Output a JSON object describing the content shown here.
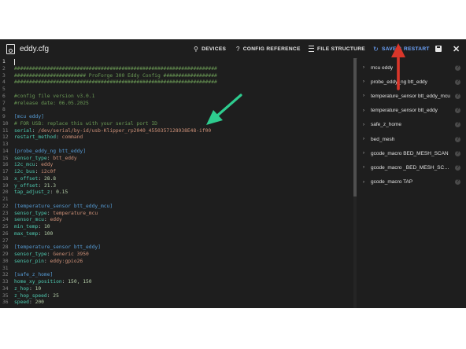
{
  "header": {
    "title": "eddy.cfg",
    "devices_label": "DEVICES",
    "config_reference_label": "CONFIG REFERENCE",
    "file_structure_label": "FILE STRUCTURE",
    "save_restart_label": "SAVE & RESTART",
    "help_glyph": "?",
    "save_restart_glyph": "↻",
    "close_glyph": "✕",
    "devices_glyph": "⚲"
  },
  "colors": {
    "accent": "#6fa6ff",
    "background": "#1e1e1e",
    "comment": "#6a9955",
    "section": "#569cd6",
    "key": "#4ec9b0",
    "string_value": "#ce9178",
    "number_value": "#b5cea8",
    "annotation_green": "#2ecc8f",
    "annotation_red": "#d9362a"
  },
  "editor": {
    "lines": [
      {
        "n": "1",
        "parts": []
      },
      {
        "n": "2",
        "parts": [
          {
            "t": "comment",
            "v": "####################################################################"
          }
        ]
      },
      {
        "n": "3",
        "parts": [
          {
            "t": "comment",
            "v": "######################## ProForge 300 Eddy Config ##################"
          }
        ]
      },
      {
        "n": "4",
        "parts": [
          {
            "t": "comment",
            "v": "####################################################################"
          }
        ]
      },
      {
        "n": "5",
        "parts": []
      },
      {
        "n": "6",
        "parts": [
          {
            "t": "comment",
            "v": "#config file version v3.0.1"
          }
        ]
      },
      {
        "n": "7",
        "parts": [
          {
            "t": "comment",
            "v": "#release date: 06.05.2025"
          }
        ]
      },
      {
        "n": "8",
        "parts": []
      },
      {
        "n": "9",
        "parts": [
          {
            "t": "section",
            "v": "[mcu eddy]"
          }
        ]
      },
      {
        "n": "10",
        "parts": [
          {
            "t": "comment",
            "v": "# FOR USB: replace this with your serial port ID"
          }
        ]
      },
      {
        "n": "11",
        "parts": [
          {
            "t": "key",
            "v": "serial"
          },
          {
            "t": "plain",
            "v": ": "
          },
          {
            "t": "val",
            "v": "/dev/serial/by-id/usb-Klipper_rp2040_4550357128938E48-if00"
          }
        ]
      },
      {
        "n": "12",
        "parts": [
          {
            "t": "key",
            "v": "restart_method"
          },
          {
            "t": "plain",
            "v": ": "
          },
          {
            "t": "val",
            "v": "command"
          }
        ]
      },
      {
        "n": "13",
        "parts": []
      },
      {
        "n": "14",
        "parts": [
          {
            "t": "section",
            "v": "[probe_eddy_ng btt_eddy]"
          }
        ]
      },
      {
        "n": "15",
        "parts": [
          {
            "t": "key",
            "v": "sensor_type"
          },
          {
            "t": "plain",
            "v": ": "
          },
          {
            "t": "val",
            "v": "btt_eddy"
          }
        ]
      },
      {
        "n": "16",
        "parts": [
          {
            "t": "key",
            "v": "i2c_mcu"
          },
          {
            "t": "plain",
            "v": ": "
          },
          {
            "t": "val",
            "v": "eddy"
          }
        ]
      },
      {
        "n": "17",
        "parts": [
          {
            "t": "key",
            "v": "i2c_bus"
          },
          {
            "t": "plain",
            "v": ": "
          },
          {
            "t": "val",
            "v": "i2c0f"
          }
        ]
      },
      {
        "n": "18",
        "parts": [
          {
            "t": "key",
            "v": "x_offset"
          },
          {
            "t": "plain",
            "v": ": "
          },
          {
            "t": "num",
            "v": "28.8"
          }
        ]
      },
      {
        "n": "19",
        "parts": [
          {
            "t": "key",
            "v": "y_offset"
          },
          {
            "t": "plain",
            "v": ": "
          },
          {
            "t": "num",
            "v": "21.3"
          }
        ]
      },
      {
        "n": "20",
        "parts": [
          {
            "t": "key",
            "v": "tap_adjust_z"
          },
          {
            "t": "plain",
            "v": ": "
          },
          {
            "t": "num",
            "v": "0.15"
          }
        ]
      },
      {
        "n": "21",
        "parts": []
      },
      {
        "n": "22",
        "parts": [
          {
            "t": "section",
            "v": "[temperature_sensor btt_eddy_mcu]"
          }
        ]
      },
      {
        "n": "23",
        "parts": [
          {
            "t": "key",
            "v": "sensor_type"
          },
          {
            "t": "plain",
            "v": ": "
          },
          {
            "t": "val",
            "v": "temperature_mcu"
          }
        ]
      },
      {
        "n": "24",
        "parts": [
          {
            "t": "key",
            "v": "sensor_mcu"
          },
          {
            "t": "plain",
            "v": ": "
          },
          {
            "t": "val",
            "v": "eddy"
          }
        ]
      },
      {
        "n": "25",
        "parts": [
          {
            "t": "key",
            "v": "min_temp"
          },
          {
            "t": "plain",
            "v": ": "
          },
          {
            "t": "num",
            "v": "10"
          }
        ]
      },
      {
        "n": "26",
        "parts": [
          {
            "t": "key",
            "v": "max_temp"
          },
          {
            "t": "plain",
            "v": ": "
          },
          {
            "t": "num",
            "v": "100"
          }
        ]
      },
      {
        "n": "27",
        "parts": []
      },
      {
        "n": "28",
        "parts": [
          {
            "t": "section",
            "v": "[temperature_sensor btt_eddy]"
          }
        ]
      },
      {
        "n": "29",
        "parts": [
          {
            "t": "key",
            "v": "sensor_type"
          },
          {
            "t": "plain",
            "v": ": "
          },
          {
            "t": "val",
            "v": "Generic 3950"
          }
        ]
      },
      {
        "n": "30",
        "parts": [
          {
            "t": "key",
            "v": "sensor_pin"
          },
          {
            "t": "plain",
            "v": ": "
          },
          {
            "t": "val",
            "v": "eddy:gpio26"
          }
        ]
      },
      {
        "n": "31",
        "parts": []
      },
      {
        "n": "32",
        "parts": [
          {
            "t": "section",
            "v": "[safe_z_home]"
          }
        ]
      },
      {
        "n": "33",
        "parts": [
          {
            "t": "key",
            "v": "home_xy_position"
          },
          {
            "t": "plain",
            "v": ": "
          },
          {
            "t": "num",
            "v": "150, 150"
          }
        ]
      },
      {
        "n": "34",
        "parts": [
          {
            "t": "key",
            "v": "z_hop"
          },
          {
            "t": "plain",
            "v": ": "
          },
          {
            "t": "num",
            "v": "10"
          }
        ]
      },
      {
        "n": "35",
        "parts": [
          {
            "t": "key",
            "v": "z_hop_speed"
          },
          {
            "t": "plain",
            "v": ": "
          },
          {
            "t": "num",
            "v": "25"
          }
        ]
      },
      {
        "n": "36",
        "parts": [
          {
            "t": "key",
            "v": "speed"
          },
          {
            "t": "plain",
            "v": ": "
          },
          {
            "t": "num",
            "v": "200"
          }
        ]
      }
    ]
  },
  "structure": {
    "chevron_glyph": "›",
    "items": [
      {
        "label": "mcu eddy"
      },
      {
        "label": "probe_eddy_ng btt_eddy"
      },
      {
        "label": "temperature_sensor btt_eddy_mcu"
      },
      {
        "label": "temperature_sensor btt_eddy"
      },
      {
        "label": "safe_z_home"
      },
      {
        "label": "bed_mesh"
      },
      {
        "label": "gcode_macro BED_MESH_SCAN"
      },
      {
        "label": "gcode_macro _BED_MESH_SCAN_SURFACE"
      },
      {
        "label": "gcode_macro TAP"
      }
    ]
  }
}
